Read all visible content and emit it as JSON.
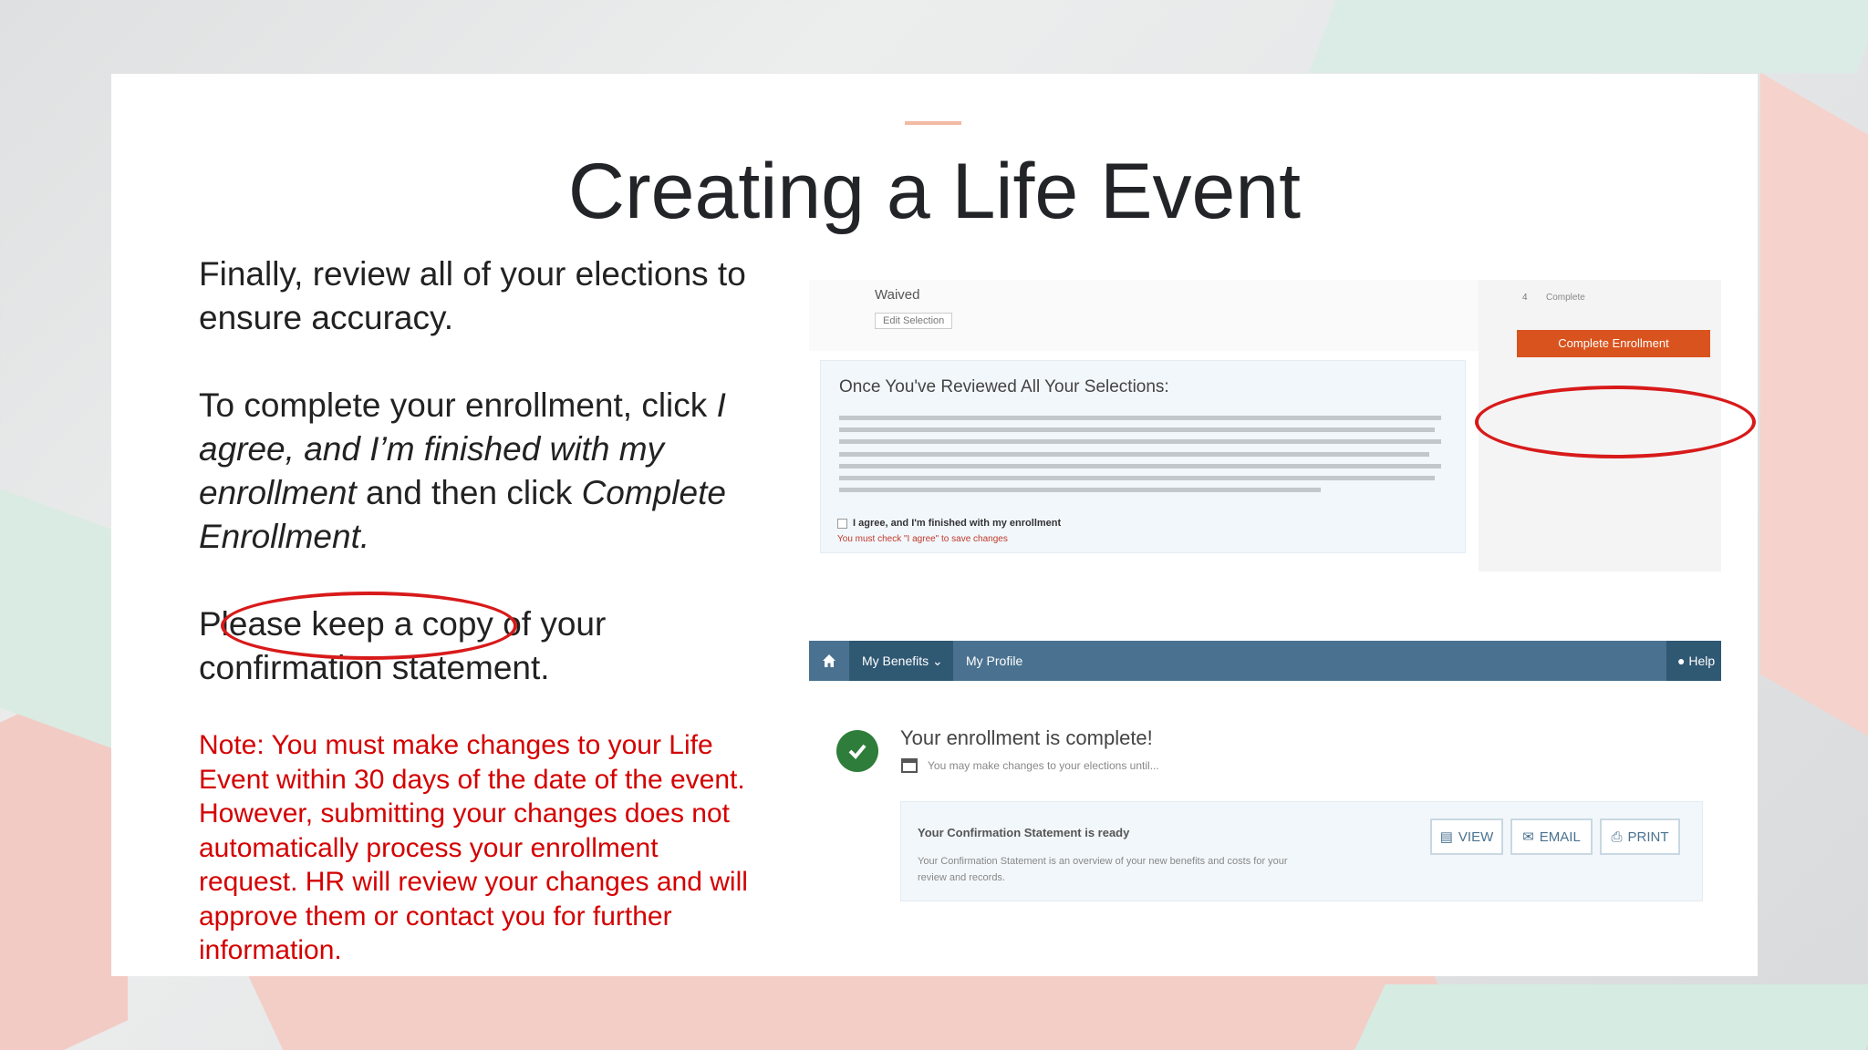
{
  "slide": {
    "title": "Creating a Life Event",
    "para1": "Finally, review all of your elections to ensure accuracy.",
    "para2_a": "To complete your enrollment, click ",
    "para2_b": "I agree, and I’m finished with my enrollment",
    "para2_c": " and then click ",
    "para2_d": "Complete Enrollment.",
    "para3": "Please keep a copy of your confirmation statement.",
    "note": "Note: You must make changes to your Life Event within 30 days of the date of the event. However, submitting your changes does not automatically process your enrollment request. HR will review your changes and will approve them or contact you for further information."
  },
  "shot1": {
    "waived_label": "Waived",
    "edit_selection": "Edit Selection",
    "review_heading": "Once You've Reviewed All Your Selections:",
    "agree_label": "I agree, and I'm finished with my enrollment",
    "agree_warning": "You must check \"I agree\" to save changes",
    "step_num": "4",
    "step_label": "Complete",
    "complete_button": "Complete Enrollment"
  },
  "shot2": {
    "nav": {
      "my_benefits": "My Benefits",
      "my_profile": "My Profile",
      "help": "Help"
    },
    "complete_heading": "Your enrollment is complete!",
    "may_change": "You may make changes to your elections until...",
    "confirm_title": "Your Confirmation Statement is ready",
    "confirm_desc": "Your Confirmation Statement is an overview of your new benefits and costs for your review and records.",
    "buttons": {
      "view": "VIEW",
      "email": "EMAIL",
      "print": "PRINT"
    }
  },
  "colors": {
    "accent_line": "#f2b9a4",
    "note_red": "#d40000",
    "nav_blue": "#4a7290",
    "complete_orange": "#d9531e",
    "success_green": "#2e7d3a",
    "circle_red": "#d81a1a"
  }
}
